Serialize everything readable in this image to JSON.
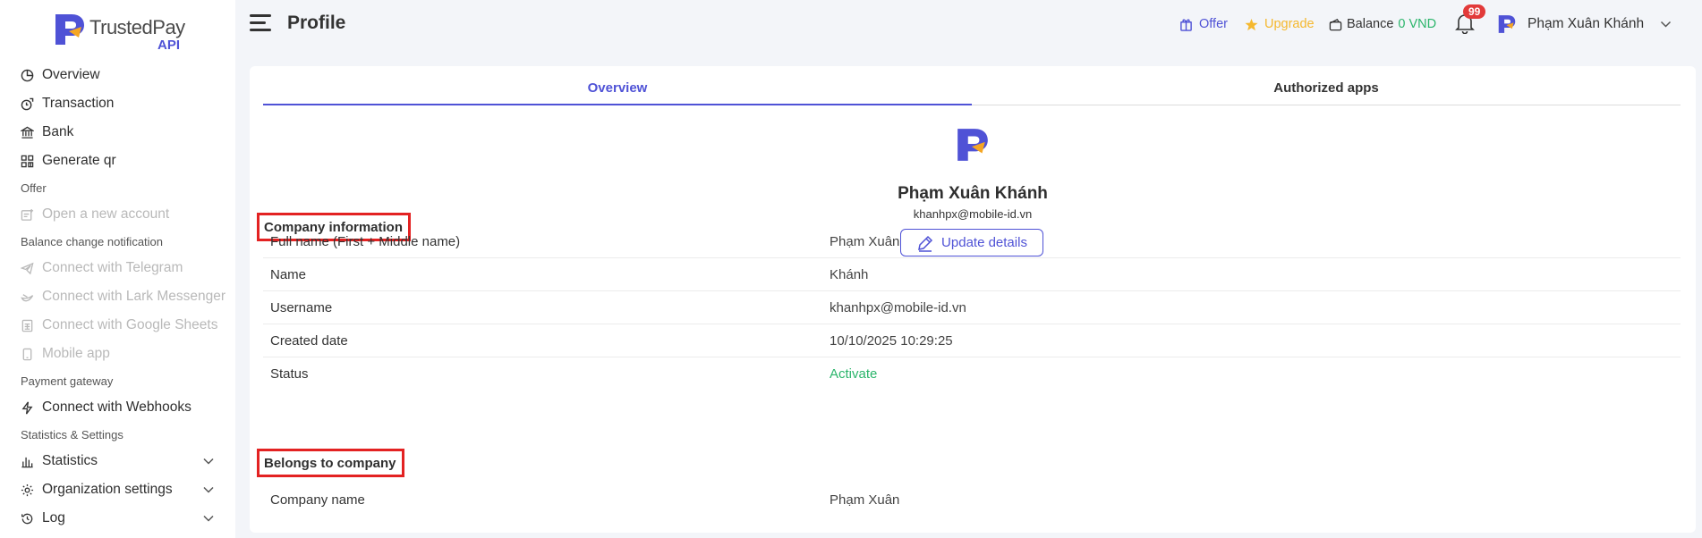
{
  "brand": {
    "name": "TrustedPay",
    "sub": "API"
  },
  "sidebar": {
    "items": [
      {
        "label": "Overview",
        "icon": "chart-pie-icon"
      },
      {
        "label": "Transaction",
        "icon": "transaction-icon"
      },
      {
        "label": "Bank",
        "icon": "bank-icon"
      },
      {
        "label": "Generate qr",
        "icon": "qr-icon"
      }
    ],
    "offer_section": "Offer",
    "offer_items": [
      {
        "label": "Open a new account",
        "icon": "new-account-icon"
      }
    ],
    "balance_section": "Balance change notification",
    "balance_items": [
      {
        "label": "Connect with Telegram",
        "icon": "telegram-icon"
      },
      {
        "label": "Connect with Lark Messenger",
        "icon": "lark-icon"
      },
      {
        "label": "Connect with Google Sheets",
        "icon": "sheets-icon"
      },
      {
        "label": "Mobile app",
        "icon": "mobile-icon"
      }
    ],
    "payment_section": "Payment gateway",
    "payment_items": [
      {
        "label": "Connect with Webhooks",
        "icon": "bolt-icon"
      }
    ],
    "stats_section": "Statistics & Settings",
    "stats_items": [
      {
        "label": "Statistics",
        "icon": "bar-chart-icon"
      },
      {
        "label": "Organization settings",
        "icon": "gear-icon"
      },
      {
        "label": "Log",
        "icon": "history-icon"
      }
    ]
  },
  "header": {
    "title": "Profile",
    "offer": "Offer",
    "upgrade": "Upgrade",
    "balance_label": "Balance",
    "balance_value": "0 VND",
    "notification_count": "99",
    "user_name": "Phạm Xuân Khánh"
  },
  "tabs": [
    "Overview",
    "Authorized apps"
  ],
  "profile": {
    "name": "Phạm Xuân Khánh",
    "email": "khanhpx@mobile-id.vn",
    "update_label": "Update details"
  },
  "company_info": {
    "title": "Company information",
    "rows": [
      {
        "label": "Full name (First + Middle name)",
        "value": "Phạm Xuân"
      },
      {
        "label": "Name",
        "value": "Khánh"
      },
      {
        "label": "Username",
        "value": "khanhpx@mobile-id.vn"
      },
      {
        "label": "Created date",
        "value": "10/10/2025 10:29:25"
      },
      {
        "label": "Status",
        "value": "Activate"
      }
    ]
  },
  "belongs": {
    "title": "Belongs to company",
    "rows": [
      {
        "label": "Company name",
        "value": "Phạm Xuân"
      }
    ]
  },
  "colors": {
    "accent": "#4f52d6",
    "orange": "#f5a623",
    "success": "#2bb56b",
    "highlight": "#e32222"
  }
}
